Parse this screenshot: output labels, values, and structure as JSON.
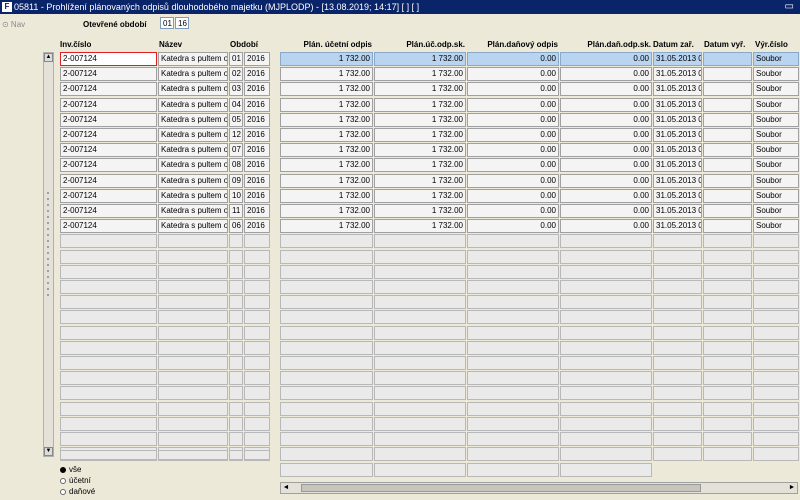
{
  "window": {
    "icon_text": "F",
    "title": "05811 - Prohlížení plánovaných odpisů dlouhodobého majetku (MJPLODP) - [13.08.2019; 14:17]  [ ]  [ ]",
    "restore_glyph": "▭"
  },
  "nav": {
    "label": "⊙ Nav"
  },
  "period": {
    "label": "Otevřené období",
    "month": "01",
    "year": "16"
  },
  "columns": {
    "inv": "Inv.číslo",
    "name": "Název",
    "period": "Období",
    "ucet": "Plán. účetní odpis",
    "ucet_sk": "Plán.úč.odp.sk.",
    "dan": "Plán.daňový odpis",
    "dan_sk": "Plán.daň.odp.sk.",
    "datum_zar": "Datum zař.",
    "datum_vyr": "Datum vyř.",
    "vyr_cislo": "Výr.číslo"
  },
  "rows": [
    {
      "inv": "2-007124",
      "name": "Katedra s pultem o",
      "m": "01",
      "y": "2016",
      "ucet": "1 732.00",
      "ucet_sk": "1 732.00",
      "dan": "0.00",
      "dan_sk": "0.00",
      "datum_zar": "31.05.2013 0",
      "datum_vyr": "",
      "vyr": "Soubor"
    },
    {
      "inv": "2-007124",
      "name": "Katedra s pultem o",
      "m": "02",
      "y": "2016",
      "ucet": "1 732.00",
      "ucet_sk": "1 732.00",
      "dan": "0.00",
      "dan_sk": "0.00",
      "datum_zar": "31.05.2013 0",
      "datum_vyr": "",
      "vyr": "Soubor"
    },
    {
      "inv": "2-007124",
      "name": "Katedra s pultem o",
      "m": "03",
      "y": "2016",
      "ucet": "1 732.00",
      "ucet_sk": "1 732.00",
      "dan": "0.00",
      "dan_sk": "0.00",
      "datum_zar": "31.05.2013 0",
      "datum_vyr": "",
      "vyr": "Soubor"
    },
    {
      "inv": "2-007124",
      "name": "Katedra s pultem o",
      "m": "04",
      "y": "2016",
      "ucet": "1 732.00",
      "ucet_sk": "1 732.00",
      "dan": "0.00",
      "dan_sk": "0.00",
      "datum_zar": "31.05.2013 0",
      "datum_vyr": "",
      "vyr": "Soubor"
    },
    {
      "inv": "2-007124",
      "name": "Katedra s pultem o",
      "m": "05",
      "y": "2016",
      "ucet": "1 732.00",
      "ucet_sk": "1 732.00",
      "dan": "0.00",
      "dan_sk": "0.00",
      "datum_zar": "31.05.2013 0",
      "datum_vyr": "",
      "vyr": "Soubor"
    },
    {
      "inv": "2-007124",
      "name": "Katedra s pultem o",
      "m": "12",
      "y": "2016",
      "ucet": "1 732.00",
      "ucet_sk": "1 732.00",
      "dan": "0.00",
      "dan_sk": "0.00",
      "datum_zar": "31.05.2013 0",
      "datum_vyr": "",
      "vyr": "Soubor"
    },
    {
      "inv": "2-007124",
      "name": "Katedra s pultem o",
      "m": "07",
      "y": "2016",
      "ucet": "1 732.00",
      "ucet_sk": "1 732.00",
      "dan": "0.00",
      "dan_sk": "0.00",
      "datum_zar": "31.05.2013 0",
      "datum_vyr": "",
      "vyr": "Soubor"
    },
    {
      "inv": "2-007124",
      "name": "Katedra s pultem o",
      "m": "08",
      "y": "2016",
      "ucet": "1 732.00",
      "ucet_sk": "1 732.00",
      "dan": "0.00",
      "dan_sk": "0.00",
      "datum_zar": "31.05.2013 0",
      "datum_vyr": "",
      "vyr": "Soubor"
    },
    {
      "inv": "2-007124",
      "name": "Katedra s pultem o",
      "m": "09",
      "y": "2016",
      "ucet": "1 732.00",
      "ucet_sk": "1 732.00",
      "dan": "0.00",
      "dan_sk": "0.00",
      "datum_zar": "31.05.2013 0",
      "datum_vyr": "",
      "vyr": "Soubor"
    },
    {
      "inv": "2-007124",
      "name": "Katedra s pultem o",
      "m": "10",
      "y": "2016",
      "ucet": "1 732.00",
      "ucet_sk": "1 732.00",
      "dan": "0.00",
      "dan_sk": "0.00",
      "datum_zar": "31.05.2013 0",
      "datum_vyr": "",
      "vyr": "Soubor"
    },
    {
      "inv": "2-007124",
      "name": "Katedra s pultem o",
      "m": "11",
      "y": "2016",
      "ucet": "1 732.00",
      "ucet_sk": "1 732.00",
      "dan": "0.00",
      "dan_sk": "0.00",
      "datum_zar": "31.05.2013 0",
      "datum_vyr": "",
      "vyr": "Soubor"
    },
    {
      "inv": "2-007124",
      "name": "Katedra s pultem o",
      "m": "06",
      "y": "2016",
      "ucet": "1 732.00",
      "ucet_sk": "1 732.00",
      "dan": "0.00",
      "dan_sk": "0.00",
      "datum_zar": "31.05.2013 0",
      "datum_vyr": "",
      "vyr": "Soubor"
    }
  ],
  "radios": [
    {
      "label": "vše",
      "checked": true
    },
    {
      "label": "účetní",
      "checked": false
    },
    {
      "label": "daňové",
      "checked": false
    }
  ],
  "colors": {
    "title_bar": "#0a246a",
    "selected_row": "#b8d4f0",
    "selected_cell_border": "#e02020"
  }
}
